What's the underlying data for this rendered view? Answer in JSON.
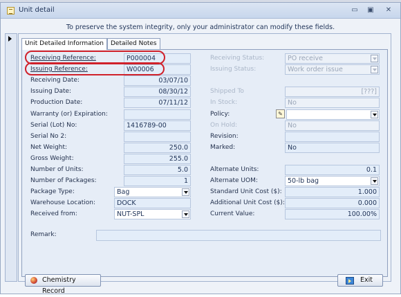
{
  "window": {
    "title": "Unit detail",
    "minimize_glyph": "▭",
    "maximize_glyph": "▣",
    "close_glyph": "✕"
  },
  "notice": "To preserve the system integrity, only your administrator can modify these fields.",
  "tabs": [
    "Unit Detailed Information",
    "Detailed Notes"
  ],
  "left": {
    "receiving_reference": {
      "label": "Receiving Reference:",
      "value": "P000004"
    },
    "issuing_reference": {
      "label": "Issuing Reference:",
      "value": "W00006"
    },
    "receiving_date": {
      "label": "Receiving Date:",
      "value": "03/07/10"
    },
    "issuing_date": {
      "label": "Issuing Date:",
      "value": "08/30/12"
    },
    "production_date": {
      "label": "Production Date:",
      "value": "07/11/12"
    },
    "warranty": {
      "label": "Warranty (or) Expiration:",
      "value": ""
    },
    "serial_lot": {
      "label": "Serial (Lot) No:",
      "value": "1416789-00"
    },
    "serial_no2": {
      "label": "Serial No 2:",
      "value": ""
    },
    "net_weight": {
      "label": "Net Weight:",
      "value": "250.0"
    },
    "gross_weight": {
      "label": "Gross Weight:",
      "value": "255.0"
    },
    "number_of_units": {
      "label": "Number of Units:",
      "value": "5.0"
    },
    "number_of_packages": {
      "label": "Number of Packages:",
      "value": "1"
    },
    "package_type": {
      "label": "Package Type:",
      "value": "Bag"
    },
    "warehouse_location": {
      "label": "Warehouse Location:",
      "value": "DOCK"
    },
    "received_from": {
      "label": "Received from:",
      "value": "NUT-SPL"
    }
  },
  "right": {
    "receiving_status": {
      "label": "Receiving Status:",
      "value": "PO receive"
    },
    "issuing_status": {
      "label": "Issuing  Status:",
      "value": "Work order issue"
    },
    "shipped_to": {
      "label": "Shipped To",
      "value": "[???]"
    },
    "in_stock": {
      "label": "In Stock:",
      "value": "No"
    },
    "policy": {
      "label": "Policy:",
      "value": ""
    },
    "on_hold": {
      "label": "On Hold:",
      "value": "No"
    },
    "revision": {
      "label": "Revision:",
      "value": ""
    },
    "marked": {
      "label": "Marked:",
      "value": "No"
    },
    "alternate_units": {
      "label": "Alternate Units:",
      "value": "0.1"
    },
    "alternate_uom": {
      "label": "Alternate UOM:",
      "value": "50-lb bag"
    },
    "standard_unit_cost": {
      "label": "Standard Unit Cost ($):",
      "value": "1.000"
    },
    "additional_unit_cost": {
      "label": "Additional Unit Cost ($):",
      "value": "0.000"
    },
    "current_value": {
      "label": "Current Value:",
      "value": "100.00%"
    }
  },
  "remark": {
    "label": "Remark:",
    "value": ""
  },
  "buttons": {
    "chemistry_record": "Chemistry Record",
    "exit": "Exit"
  },
  "colors": {
    "highlight_ring": "#d0202a",
    "field_bg": "#e3edf9",
    "panel_bg": "#e6edf7"
  },
  "icons": [
    "document-icon",
    "pencil-icon",
    "chemistry-icon",
    "exit-door-icon",
    "dropdown-arrow-icon",
    "record-pointer-icon"
  ]
}
